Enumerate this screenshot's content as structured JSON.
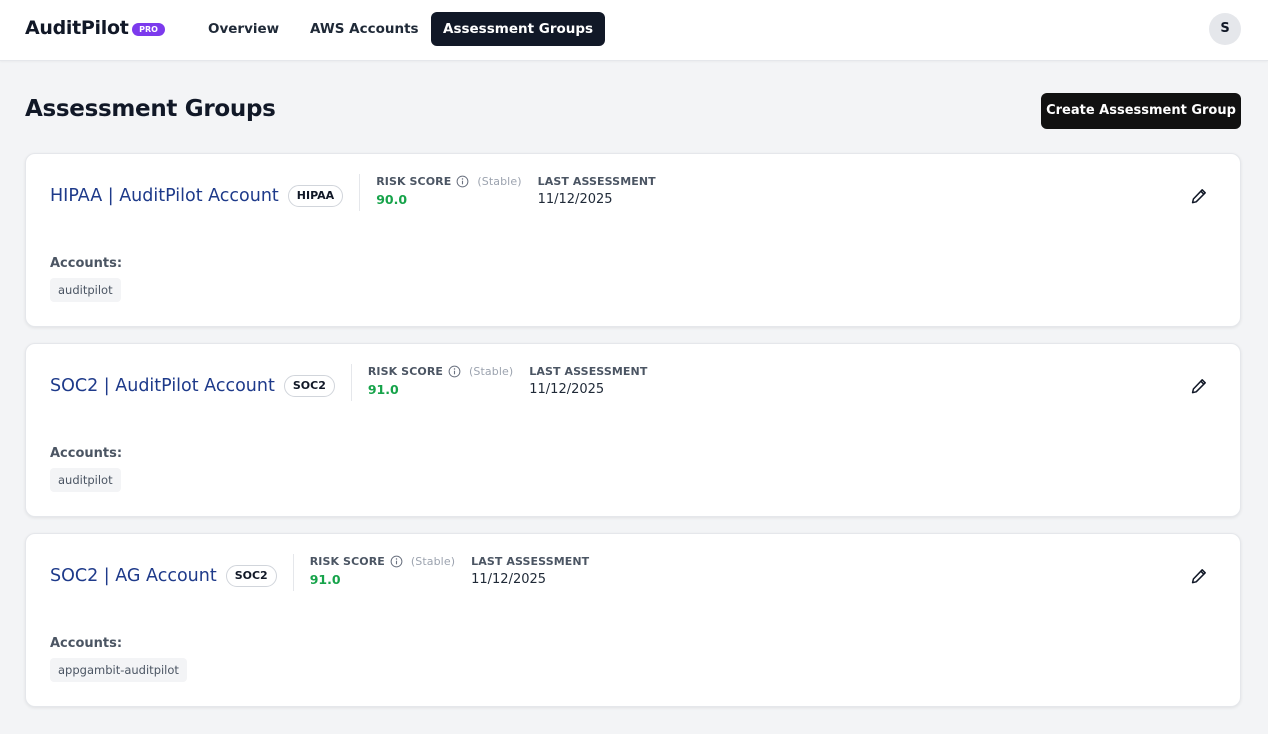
{
  "app": {
    "name": "AuditPilot",
    "badge": "PRO"
  },
  "nav": {
    "items": [
      {
        "label": "Overview",
        "active": false
      },
      {
        "label": "AWS Accounts",
        "active": false
      },
      {
        "label": "Assessment Groups",
        "active": true
      }
    ]
  },
  "user": {
    "initial": "S"
  },
  "page": {
    "title": "Assessment Groups",
    "create_button": "Create Assessment Group"
  },
  "labels": {
    "risk_score": "RISK SCORE",
    "last_assessment": "LAST ASSESSMENT",
    "accounts": "Accounts:"
  },
  "colors": {
    "accent": "#111827",
    "pro_badge": "#7c3aed",
    "group_name": "#1e3a8a",
    "score_good": "#16a34a"
  },
  "groups": [
    {
      "name": "HIPAA | AuditPilot Account",
      "framework": "HIPAA",
      "risk_score": "90.0",
      "trend": "(Stable)",
      "last_assessment": "11/12/2025",
      "accounts": [
        "auditpilot"
      ]
    },
    {
      "name": "SOC2 | AuditPilot Account",
      "framework": "SOC2",
      "risk_score": "91.0",
      "trend": "(Stable)",
      "last_assessment": "11/12/2025",
      "accounts": [
        "auditpilot"
      ]
    },
    {
      "name": "SOC2 | AG Account",
      "framework": "SOC2",
      "risk_score": "91.0",
      "trend": "(Stable)",
      "last_assessment": "11/12/2025",
      "accounts": [
        "appgambit-auditpilot"
      ]
    }
  ]
}
